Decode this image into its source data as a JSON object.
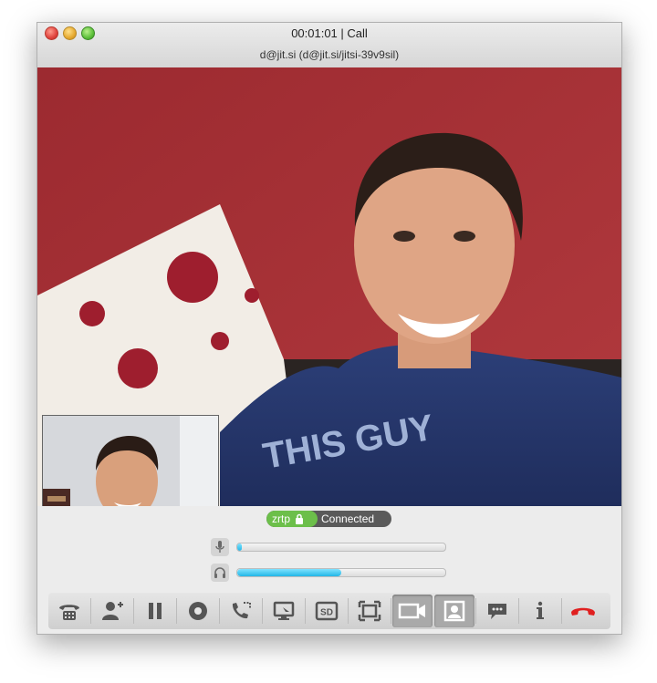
{
  "window": {
    "title": "00:01:01 | Call",
    "subtitle": "d@jit.si (d@jit.si/jitsi-39v9sil)"
  },
  "status": {
    "zrtp_label": "zrtp",
    "state": "Connected",
    "colors": {
      "zrtp": "#6cbf4a",
      "pill": "#5a5a5a"
    }
  },
  "meters": {
    "microphone_level": 0.02,
    "speaker_level": 0.5,
    "fill_color": "#22b6e6"
  },
  "toolbar": {
    "buttons": [
      {
        "icon": "dialpad-phone-icon"
      },
      {
        "icon": "add-participant-icon"
      },
      {
        "icon": "pause-icon"
      },
      {
        "icon": "record-icon"
      },
      {
        "icon": "transfer-call-icon"
      },
      {
        "icon": "desktop-share-icon"
      },
      {
        "icon": "sd-quality-icon"
      },
      {
        "icon": "fullscreen-icon"
      },
      {
        "icon": "video-camera-icon",
        "active": true
      },
      {
        "icon": "local-video-icon",
        "active": true
      },
      {
        "icon": "chat-icon"
      },
      {
        "icon": "info-icon"
      },
      {
        "icon": "hangup-icon"
      }
    ]
  }
}
